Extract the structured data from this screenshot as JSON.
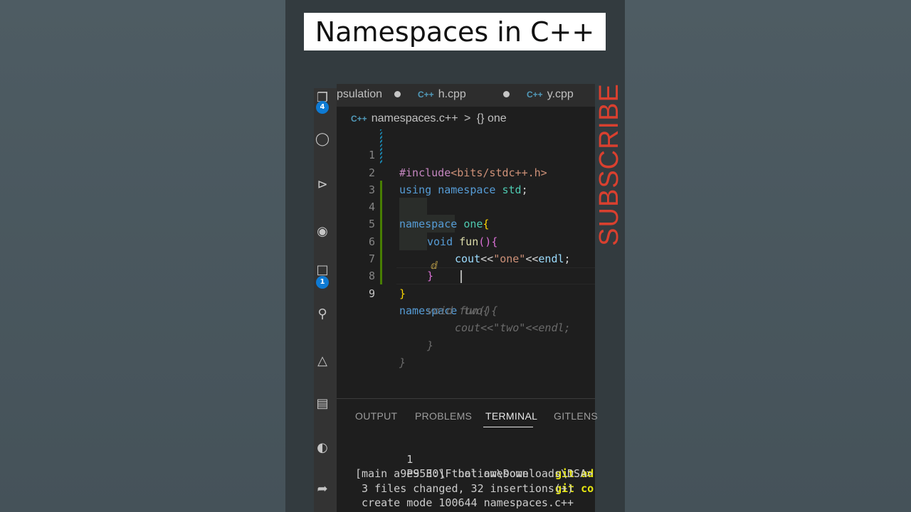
{
  "title": "Namespaces in C++",
  "subscribe": "SUBSCRIBE",
  "colors": {
    "accent_red": "#d9402f",
    "editor_bg": "#1e1e1e",
    "badge_blue": "#0e7ad3"
  },
  "activity_bar": {
    "icons": [
      "explorer-icon",
      "search-icon",
      "source-control-icon",
      "run-debug-icon",
      "extensions-icon",
      "remote-icon",
      "testing-icon",
      "notebook-icon",
      "gitlens-icon",
      "live-share-icon"
    ],
    "badges": {
      "explorer": "4",
      "extensions": "1"
    }
  },
  "tabs": [
    {
      "label": "psulation",
      "icon": "dot"
    },
    {
      "label": "h.cpp",
      "icon": "C++"
    },
    {
      "label": "y.cpp",
      "icon": "C++"
    }
  ],
  "breadcrumb": {
    "file": "namespaces.c++",
    "separator": ">",
    "symbol_icon": "{}",
    "symbol": "one"
  },
  "code": {
    "line_numbers": [
      "1",
      "2",
      "3",
      "4",
      "5",
      "6",
      "7",
      "8",
      "9"
    ],
    "l1_pp": "#include",
    "l1_inc": "<bits/stdc++.h>",
    "l2_kw1": "using",
    "l2_kw2": "namespace",
    "l2_id": "std",
    "l2_semi": ";",
    "l4_kw": "namespace",
    "l4_name": "one",
    "l4_brace": "{",
    "l5_kw": "void",
    "l5_fn": "fun",
    "l5_paren": "()",
    "l5_brace": "{",
    "l6_id": "cout",
    "l6_op1": "<<",
    "l6_str": "\"one\"",
    "l6_op2": "<<",
    "l6_endl": "endl",
    "l6_semi": ";",
    "l7_brace": "}",
    "l8_brace": "}",
    "l9_kw": "namespace",
    "ghost": [
      "two{",
      "void fun(){",
      "cout<<\"two\"<<endl;",
      "}",
      "}"
    ]
  },
  "panel": {
    "tabs": [
      "OUTPUT",
      "PROBLEMS",
      "TERMINAL",
      "GITLENS"
    ],
    "active_tab": "TERMINAL",
    "terminal": {
      "l1": "1",
      "l1_git": "git ad",
      "l2": "PS E:\\F boliom\\Downloads\\DSA>",
      "l2_git": "git co",
      "l3": "[main a9e9530] that awesome",
      "l4": " 3 files changed, 32 insertions(+)",
      "l5": " create mode 100644 namespaces.c++"
    }
  }
}
